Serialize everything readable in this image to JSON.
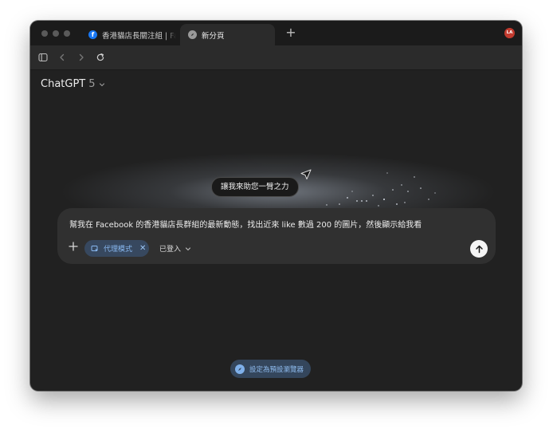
{
  "browser": {
    "tabs": [
      {
        "label": "香港貓店長關注組 | Fa",
        "icon": "facebook-icon",
        "active": false
      },
      {
        "label": "新分頁",
        "icon": "compass-icon",
        "active": true
      }
    ],
    "new_tab_symbol": "+",
    "profile_initials": "LA"
  },
  "main": {
    "model_name": "ChatGPT",
    "model_version": "5",
    "tooltip": "讓我來助您一臂之力",
    "composer": {
      "prompt_text": "幫我在 Facebook 的香港貓店長群組的最新動態，找出近來 like 數過 200 的圖片，然後顯示給我看",
      "agent_chip_label": "代理模式",
      "agent_chip_close": "✕",
      "logged_in_label": "已登入"
    },
    "set_default_label": "設定為預設瀏覽器"
  },
  "colors": {
    "window_bg": "#212121",
    "composer_bg": "#303030",
    "accent_blue": "#88b8f0",
    "profile_red": "#c23b2f"
  }
}
